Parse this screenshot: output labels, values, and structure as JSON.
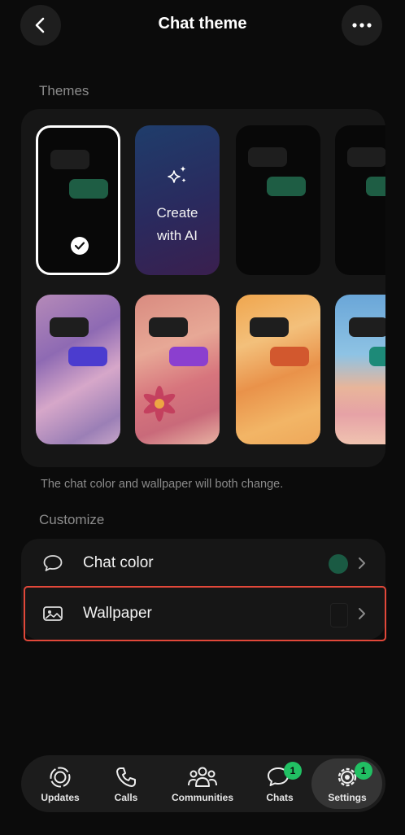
{
  "header": {
    "title": "Chat theme",
    "back_icon": "chevron-left-icon",
    "more_icon": "more-horizontal-icon"
  },
  "themes": {
    "section_label": "Themes",
    "selected_index": 0,
    "cards": [
      {
        "kind": "default",
        "selected": true,
        "out_bubble_color": "#1e5d44"
      },
      {
        "kind": "ai",
        "label_line1": "Create",
        "label_line2": "with AI",
        "icon": "sparkles-icon"
      },
      {
        "kind": "dark",
        "out_bubble_color": "#1e5d44"
      },
      {
        "kind": "dark",
        "out_bubble_color": "#1e5d44"
      },
      {
        "kind": "wallpaper",
        "out_bubble_color": "#4b3ccf"
      },
      {
        "kind": "wallpaper",
        "out_bubble_color": "#8b3fcf"
      },
      {
        "kind": "wallpaper",
        "out_bubble_color": "#d2582e"
      },
      {
        "kind": "wallpaper",
        "out_bubble_color": "#1d8a78"
      }
    ],
    "caption": "The chat color and wallpaper will both change."
  },
  "customize": {
    "section_label": "Customize",
    "rows": [
      {
        "label": "Chat color",
        "icon": "chat-bubble-icon",
        "swatch_color": "#1a5a43"
      },
      {
        "label": "Wallpaper",
        "icon": "wallpaper-image-icon",
        "swatch_color": "#151515"
      }
    ]
  },
  "nav": {
    "items": [
      {
        "label": "Updates",
        "icon": "updates-icon"
      },
      {
        "label": "Calls",
        "icon": "phone-icon"
      },
      {
        "label": "Communities",
        "icon": "communities-icon"
      },
      {
        "label": "Chats",
        "icon": "chats-icon",
        "badge": "1"
      },
      {
        "label": "Settings",
        "icon": "settings-gear-icon",
        "badge": "1",
        "active": true
      }
    ]
  },
  "colors": {
    "accent_green": "#21c063",
    "highlight_red": "#e2483a",
    "background": "#0b0b0b"
  }
}
